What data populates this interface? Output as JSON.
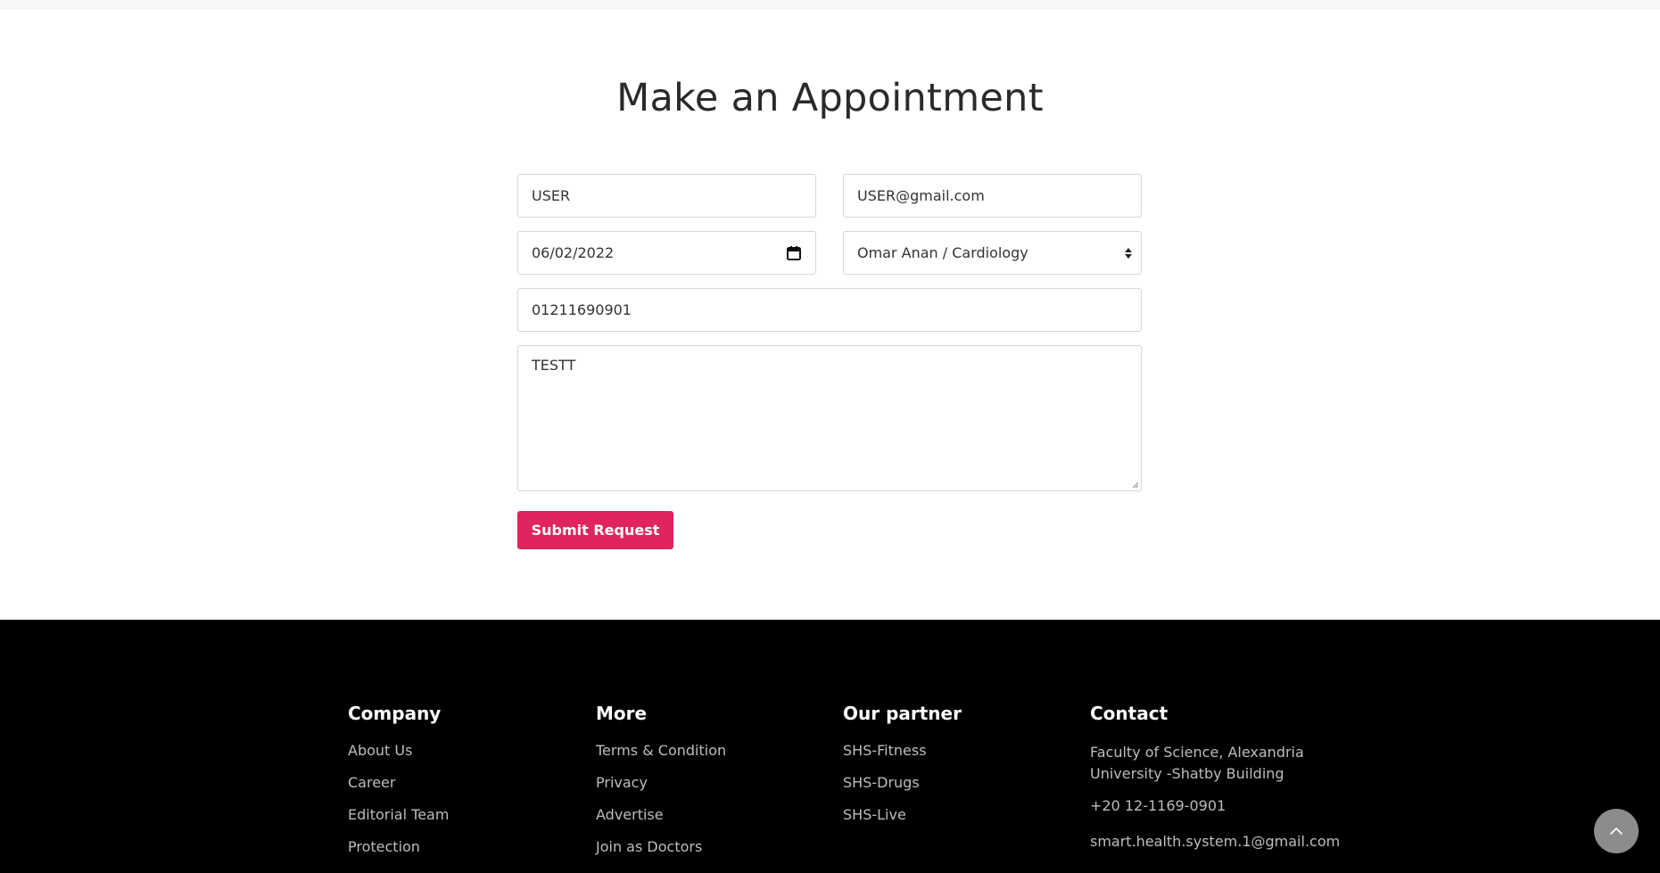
{
  "appointment": {
    "title": "Make an Appointment",
    "name_value": "USER",
    "email_value": "USER@gmail.com",
    "date_value": "06/02/2022",
    "doctor_value": "Omar Anan / Cardiology",
    "phone_value": "01211690901",
    "message_value": "TESTT",
    "submit_label": "Submit Request"
  },
  "footer": {
    "company": {
      "heading": "Company",
      "links": [
        "About Us",
        "Career",
        "Editorial Team",
        "Protection"
      ]
    },
    "more": {
      "heading": "More",
      "links": [
        "Terms & Condition",
        "Privacy",
        "Advertise",
        "Join as Doctors"
      ]
    },
    "partner": {
      "heading": "Our partner",
      "links": [
        "SHS-Fitness",
        "SHS-Drugs",
        "SHS-Live"
      ]
    },
    "contact": {
      "heading": "Contact",
      "address": "Faculty of Science, Alexandria University -Shatby Building",
      "phone": "+20 12-1169-0901",
      "email": "smart.health.system.1@gmail.com"
    }
  },
  "icons": {
    "calendar": "calendar-icon",
    "select_arrows": "select-arrows-icon",
    "scroll_top": "chevron-up-icon"
  },
  "colors": {
    "accent": "#e0245e",
    "footer_bg": "#000000",
    "scroll_button": "#8c8c8c"
  }
}
